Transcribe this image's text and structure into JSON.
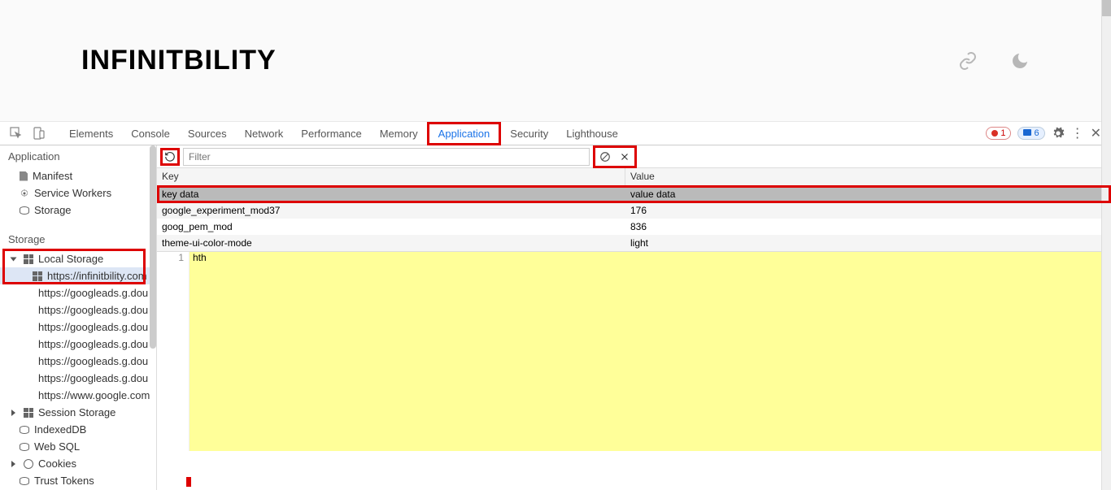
{
  "brand": "INFINITBILITY",
  "devtools_tabs": [
    "Elements",
    "Console",
    "Sources",
    "Network",
    "Performance",
    "Memory",
    "Application",
    "Security",
    "Lighthouse"
  ],
  "devtools_active_tab": "Application",
  "error_count": "1",
  "info_count": "6",
  "sidebar": {
    "section_app": "Application",
    "app_items": [
      {
        "label": "Manifest",
        "icon": "file"
      },
      {
        "label": "Service Workers",
        "icon": "gear"
      },
      {
        "label": "Storage",
        "icon": "db"
      }
    ],
    "section_storage": "Storage",
    "local_storage": "Local Storage",
    "local_storage_domains": [
      "https://infinitbility.com",
      "https://googleads.g.dou",
      "https://googleads.g.dou",
      "https://googleads.g.dou",
      "https://googleads.g.dou",
      "https://googleads.g.dou",
      "https://googleads.g.dou",
      "https://www.google.com"
    ],
    "session_storage": "Session Storage",
    "indexeddb": "IndexedDB",
    "websql": "Web SQL",
    "cookies": "Cookies",
    "trust_tokens": "Trust Tokens"
  },
  "toolbar": {
    "filter_placeholder": "Filter"
  },
  "table": {
    "key_header": "Key",
    "value_header": "Value",
    "rows": [
      {
        "key": "key data",
        "value": "value data",
        "hl": true
      },
      {
        "key": "google_experiment_mod37",
        "value": "176"
      },
      {
        "key": "goog_pem_mod",
        "value": "836"
      },
      {
        "key": "theme-ui-color-mode",
        "value": "light"
      }
    ]
  },
  "detail": {
    "line": "1",
    "text": "hth"
  }
}
